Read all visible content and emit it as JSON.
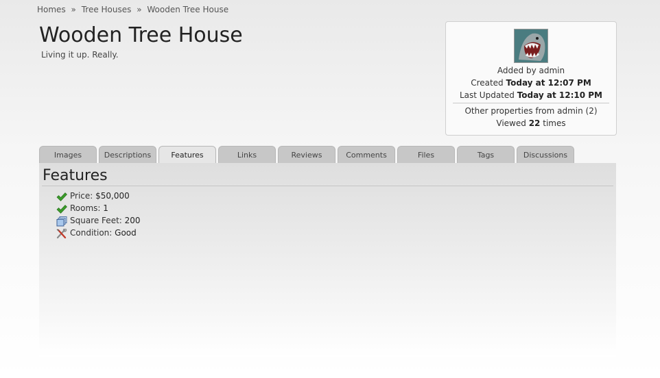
{
  "breadcrumb": {
    "items": [
      "Homes",
      "Tree Houses",
      "Wooden Tree House"
    ],
    "separator": "»"
  },
  "listing": {
    "title": "Wooden Tree House",
    "subtitle": "Living it up. Really."
  },
  "info_box": {
    "added_by": "Added by admin",
    "created_label": "Created",
    "created_value": "Today at 12:07 PM",
    "updated_label": "Last Updated",
    "updated_value": "Today at 12:10 PM",
    "other_properties": "Other properties from admin (2)",
    "viewed_prefix": "Viewed",
    "viewed_count": "22",
    "viewed_suffix": "times"
  },
  "tabs": [
    {
      "label": "Images",
      "active": false
    },
    {
      "label": "Descriptions",
      "active": false
    },
    {
      "label": "Features",
      "active": true
    },
    {
      "label": "Links",
      "active": false
    },
    {
      "label": "Reviews",
      "active": false
    },
    {
      "label": "Comments",
      "active": false
    },
    {
      "label": "Files",
      "active": false
    },
    {
      "label": "Tags",
      "active": false
    },
    {
      "label": "Discussions",
      "active": false
    }
  ],
  "features_panel": {
    "heading": "Features",
    "items": [
      {
        "icon": "checkmark-icon",
        "label": "Price:",
        "value": "$50,000"
      },
      {
        "icon": "checkmark-icon",
        "label": "Rooms:",
        "value": "1"
      },
      {
        "icon": "stacked-squares-icon",
        "label": "Square Feet:",
        "value": "200"
      },
      {
        "icon": "tools-icon",
        "label": "Condition:",
        "value": "Good"
      }
    ]
  },
  "colors": {
    "check_green": "#3a9b2a",
    "tab_bg": "#c7c7c7",
    "tab_active_bg": "#e6e6e6",
    "panel_bg": "#dedede"
  }
}
